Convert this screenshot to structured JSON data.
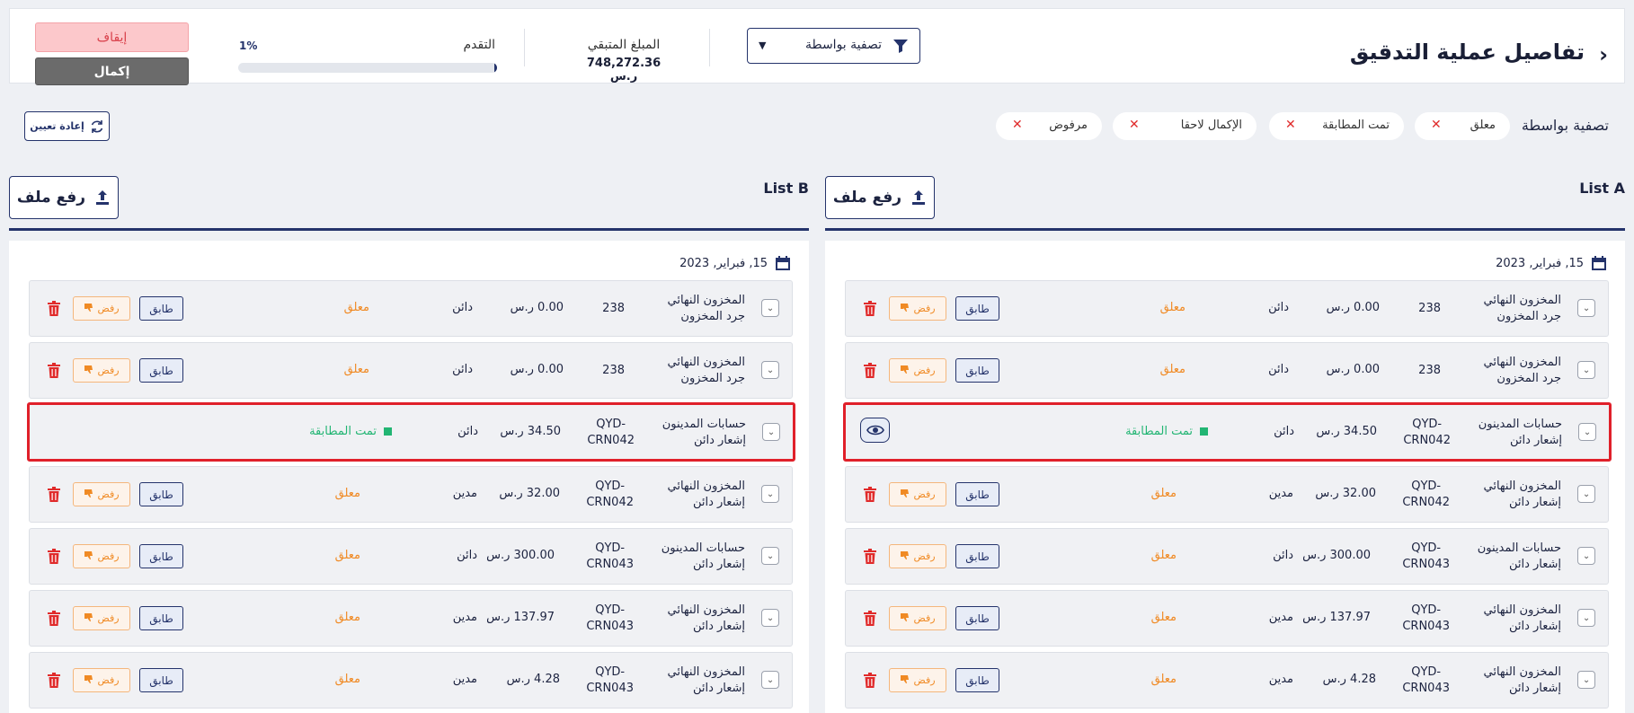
{
  "header": {
    "title": "تفاصيل عملية التدقيق",
    "filter_dropdown_label": "تصفية بواسطة",
    "remaining_label": "المبلغ المتبقي",
    "remaining_value": "748,272.36 ر.س",
    "progress_label": "التقدم",
    "progress_text": "1%",
    "progress_value": 0.01,
    "stop_label": "إيقاف",
    "complete_label": "إكمال"
  },
  "filters": {
    "label": "تصفية بواسطة",
    "chips": [
      "معلق",
      "تمت المطابقة",
      "الإكمال لاحقا",
      "مرفوض"
    ],
    "reset_label": "إعادة تعيين"
  },
  "colors": {
    "primary": "#24336b",
    "pending": "#f08a24",
    "matched": "#22b573",
    "danger": "#e02b2b"
  },
  "lists": [
    {
      "title": "List A",
      "upload_label": "رفع ملف",
      "date": "15, فبراير, 2023",
      "rows": [
        {
          "account": "المخزون النهائي",
          "subtitle": "جرد المخزون",
          "ref": "238",
          "amount": "0.00 ر.س",
          "type": "دائن",
          "status": "معلق"
        },
        {
          "account": "المخزون النهائي",
          "subtitle": "جرد المخزون",
          "ref": "238",
          "amount": "0.00 ر.س",
          "type": "دائن",
          "status": "معلق"
        },
        {
          "account": "حسابات المدينون",
          "subtitle": "إشعار دائن",
          "ref": "QYD-\nCRN042",
          "amount": "34.50 ر.س",
          "type": "دائن",
          "status": "تمت المطابقة"
        },
        {
          "account": "المخزون النهائي",
          "subtitle": "إشعار دائن",
          "ref": "QYD-\nCRN042",
          "amount": "32.00 ر.س",
          "type": "مدين",
          "status": "معلق"
        },
        {
          "account": "حسابات المدينون",
          "subtitle": "إشعار دائن",
          "ref": "QYD-\nCRN043",
          "amount": "300.00 ر.س",
          "type": "دائن",
          "status": "معلق"
        },
        {
          "account": "المخزون النهائي",
          "subtitle": "إشعار دائن",
          "ref": "QYD-\nCRN043",
          "amount": "137.97 ر.س",
          "type": "مدين",
          "status": "معلق"
        },
        {
          "account": "المخزون النهائي",
          "subtitle": "إشعار دائن",
          "ref": "QYD-\nCRN043",
          "amount": "4.28 ر.س",
          "type": "مدين",
          "status": "معلق"
        }
      ]
    },
    {
      "title": "List B",
      "upload_label": "رفع ملف",
      "date": "15, فبراير, 2023",
      "rows": [
        {
          "account": "المخزون النهائي",
          "subtitle": "جرد المخزون",
          "ref": "238",
          "amount": "0.00 ر.س",
          "type": "دائن",
          "status": "معلق"
        },
        {
          "account": "المخزون النهائي",
          "subtitle": "جرد المخزون",
          "ref": "238",
          "amount": "0.00 ر.س",
          "type": "دائن",
          "status": "معلق"
        },
        {
          "account": "حسابات المدينون",
          "subtitle": "إشعار دائن",
          "ref": "QYD-\nCRN042",
          "amount": "34.50 ر.س",
          "type": "دائن",
          "status": "تمت المطابقة"
        },
        {
          "account": "المخزون النهائي",
          "subtitle": "إشعار دائن",
          "ref": "QYD-\nCRN042",
          "amount": "32.00 ر.س",
          "type": "مدين",
          "status": "معلق"
        },
        {
          "account": "حسابات المدينون",
          "subtitle": "إشعار دائن",
          "ref": "QYD-\nCRN043",
          "amount": "300.00 ر.س",
          "type": "دائن",
          "status": "معلق"
        },
        {
          "account": "المخزون النهائي",
          "subtitle": "إشعار دائن",
          "ref": "QYD-\nCRN043",
          "amount": "137.97 ر.س",
          "type": "مدين",
          "status": "معلق"
        },
        {
          "account": "المخزون النهائي",
          "subtitle": "إشعار دائن",
          "ref": "QYD-\nCRN043",
          "amount": "4.28 ر.س",
          "type": "مدين",
          "status": "معلق"
        }
      ]
    }
  ],
  "row_actions": {
    "match_label": "طابق",
    "reject_label": "رفض"
  }
}
